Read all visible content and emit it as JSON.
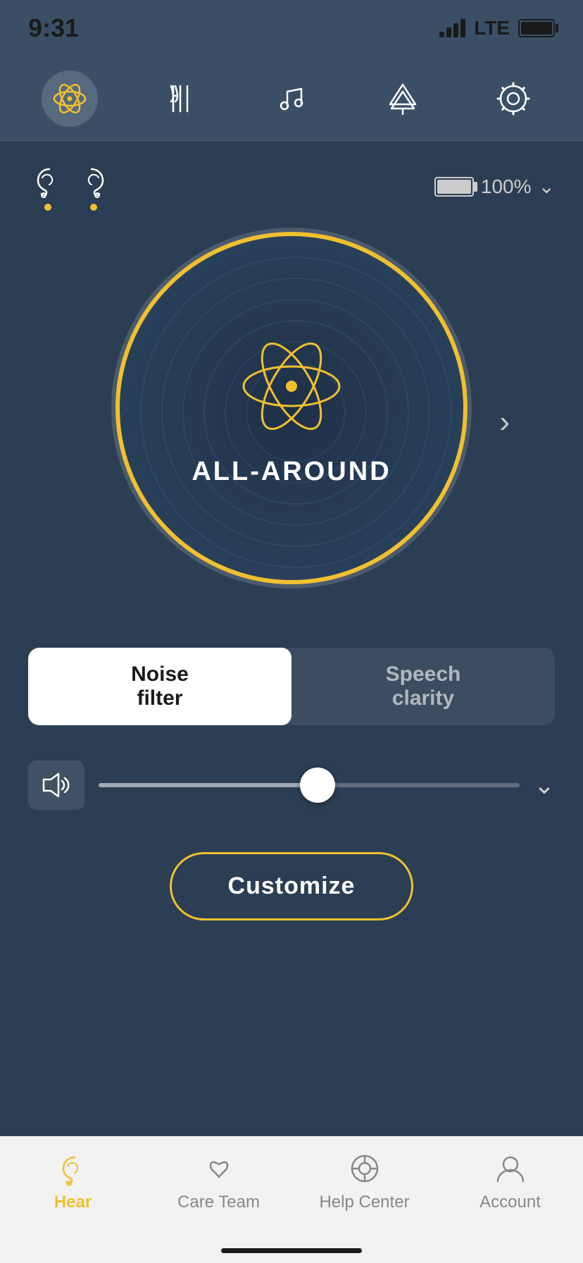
{
  "statusBar": {
    "time": "9:31",
    "batteryPercent": "100%",
    "lte": "LTE"
  },
  "topNav": {
    "icons": [
      {
        "name": "all-around-icon",
        "label": "All Around",
        "active": true
      },
      {
        "name": "restaurant-icon",
        "label": "Restaurant",
        "active": false
      },
      {
        "name": "music-icon",
        "label": "Music",
        "active": false
      },
      {
        "name": "outdoor-icon",
        "label": "Outdoor",
        "active": false
      },
      {
        "name": "settings-icon",
        "label": "Settings",
        "active": false
      }
    ]
  },
  "deviceHeader": {
    "batteryPercent": "100%"
  },
  "circleDisplay": {
    "modeName": "ALL-AROUND"
  },
  "toggle": {
    "option1": "Noise\nfilter",
    "option2": "Speech\nclarity",
    "activeIndex": 0
  },
  "volumeSlider": {
    "fillPercent": 52
  },
  "customizeButton": {
    "label": "Customize"
  },
  "bottomNav": {
    "items": [
      {
        "name": "hear",
        "label": "Hear",
        "active": true
      },
      {
        "name": "care-team",
        "label": "Care Team",
        "active": false
      },
      {
        "name": "help-center",
        "label": "Help Center",
        "active": false
      },
      {
        "name": "account",
        "label": "Account",
        "active": false
      }
    ]
  }
}
